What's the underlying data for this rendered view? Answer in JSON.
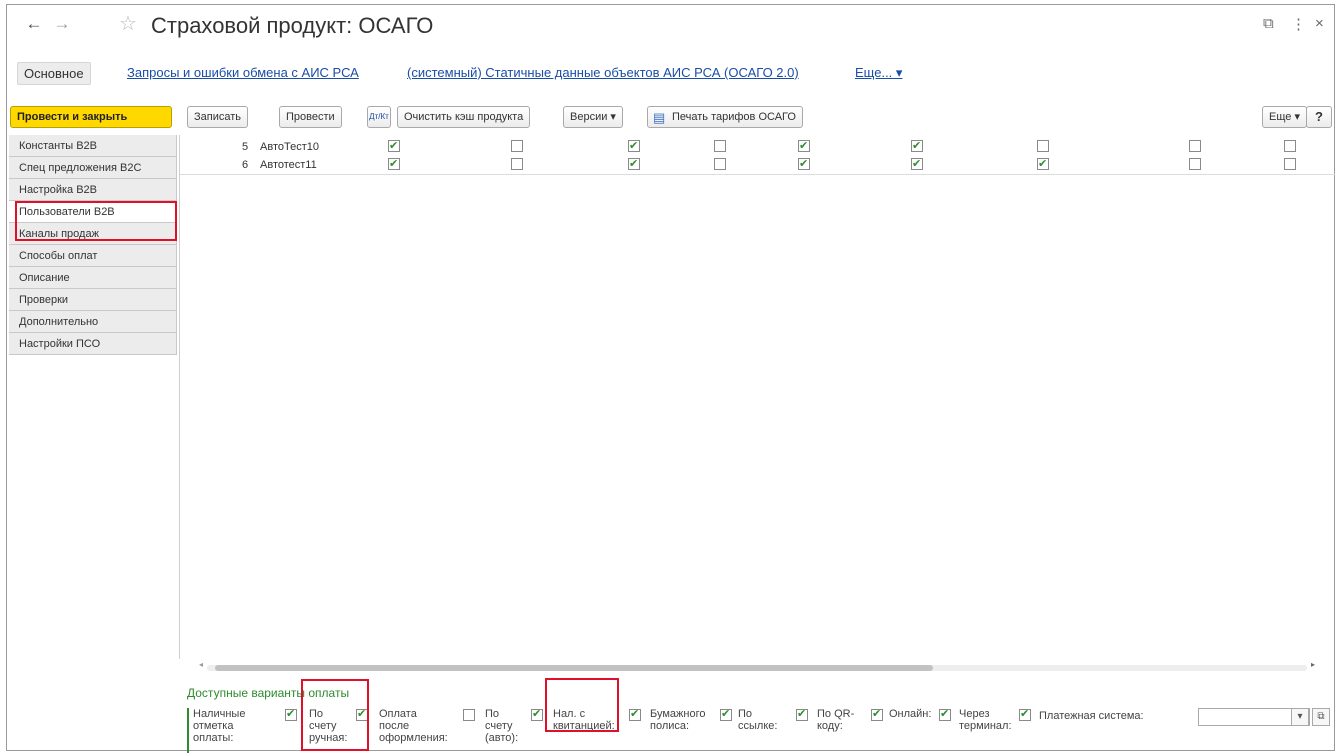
{
  "window": {
    "title": "Страховой продукт: ОСАГО",
    "back_icon": "←",
    "forward_icon": "→",
    "star_icon": "☆",
    "link_icon": "⧉",
    "menu_icon": "⋮",
    "close_icon": "×"
  },
  "tabs": {
    "main": "Основное",
    "links": [
      "Запросы и ошибки обмена с АИС РСА",
      "(системный) Статичные данные объектов АИС РСА (ОСАГО 2.0)",
      "Еще... ▾"
    ]
  },
  "toolbar": {
    "post_close": "Провести и закрыть",
    "save": "Записать",
    "post": "Провести",
    "dt_kt": "Дт/Кт",
    "clear_cache": "Очистить кэш продукта",
    "versions": "Версии ▾",
    "print_tariffs": "Печать тарифов ОСАГО",
    "more": "Еще ▾",
    "help": "?"
  },
  "sidebar": {
    "items": [
      "Константы B2B",
      "Спец предложения B2C",
      "Настройка B2B",
      "Пользователи B2B",
      "Каналы продаж",
      "Способы оплат",
      "Описание",
      "Проверки",
      "Дополнительно",
      "Настройки ПСО"
    ],
    "active_index": 3
  },
  "grid": {
    "rows": [
      {
        "num": "5",
        "name": "АвтоТест10",
        "checks": [
          true,
          false,
          true,
          false,
          true,
          true,
          false,
          false,
          false
        ]
      },
      {
        "num": "6",
        "name": "Автотест11",
        "checks": [
          true,
          false,
          true,
          false,
          true,
          true,
          true,
          false,
          false
        ]
      }
    ]
  },
  "payments": {
    "title": "Доступные варианты оплаты",
    "options": [
      {
        "label": "Наличные отметка оплаты:",
        "checked": true
      },
      {
        "label": "По счету ручная:",
        "checked": true
      },
      {
        "label": "Оплата после оформления:",
        "checked": false
      },
      {
        "label": "По счету (авто):",
        "checked": true
      },
      {
        "label": "Нал. с квитанцией:",
        "checked": true
      },
      {
        "label": "Бумажного полиса:",
        "checked": true
      },
      {
        "label": "По ссылке:",
        "checked": true
      },
      {
        "label": "По QR-коду:",
        "checked": true
      },
      {
        "label": "Онлайн:",
        "checked": true
      },
      {
        "label": "Через терминал:",
        "checked": true
      }
    ],
    "payment_system_label": "Платежная система:",
    "payment_system_value": ""
  }
}
